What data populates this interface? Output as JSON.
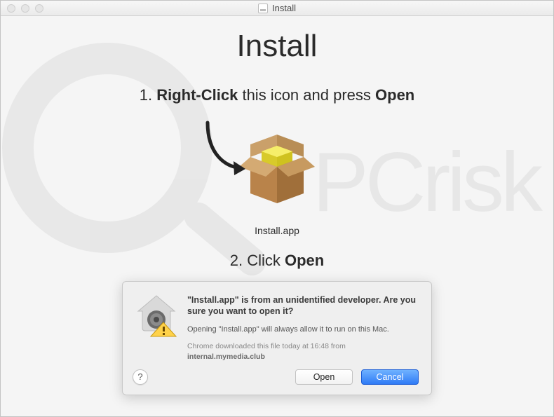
{
  "window": {
    "title": "Install"
  },
  "heading": "Install",
  "step1": {
    "prefix": "1. ",
    "bold1": "Right-Click",
    "mid": " this icon and press ",
    "bold2": "Open"
  },
  "fileLabel": "Install.app",
  "step2": {
    "prefix": "2. Click ",
    "bold": "Open"
  },
  "dialog": {
    "title": "\"Install.app\" is from an unidentified developer. Are you sure you want to open it?",
    "sub": "Opening \"Install.app\" will always allow it to run on this Mac.",
    "metaLine1": "Chrome downloaded this file today at 16:48 from",
    "metaSource": "internal.mymedia.club",
    "help": "?",
    "openLabel": "Open",
    "cancelLabel": "Cancel"
  },
  "watermarkText": "PCrisk"
}
